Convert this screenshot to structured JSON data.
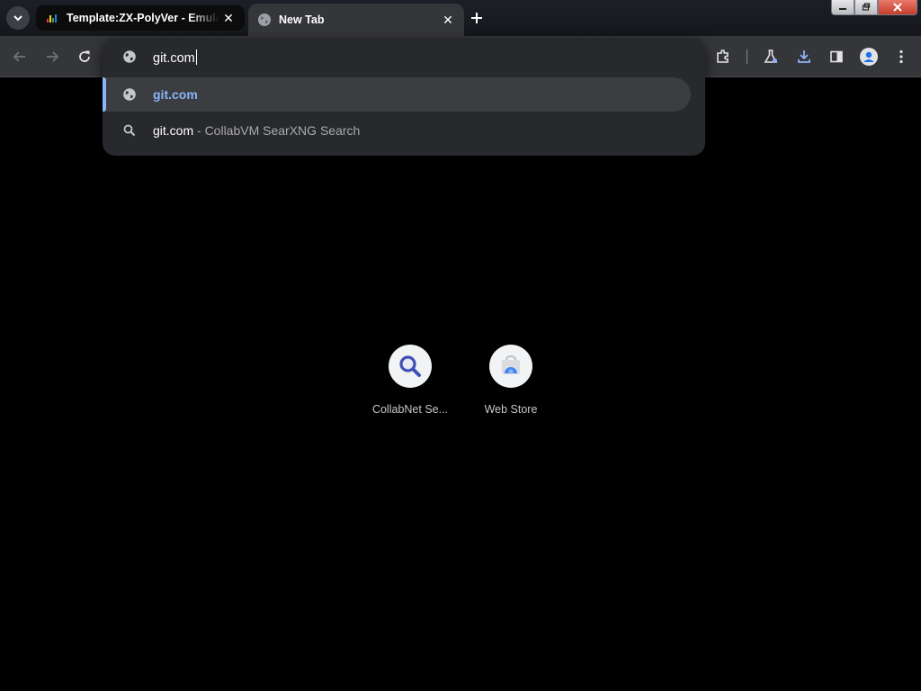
{
  "browser": {
    "tabs": [
      {
        "title": "Template:ZX-PolyVer - Emulati",
        "icon": "colorful-favicon-icon",
        "active": false
      },
      {
        "title": "New Tab",
        "icon": "globe-icon",
        "active": true
      }
    ],
    "new_tab_icon": "plus-icon",
    "tab_search_icon": "chevron-down-icon"
  },
  "toolbar": {
    "icons": [
      "back-icon",
      "forward-icon",
      "reload-icon",
      "extensions-icon",
      "labs-icon",
      "download-icon",
      "side-panel-icon",
      "profile-icon",
      "menu-icon"
    ]
  },
  "omnibox": {
    "value": "git.com",
    "suggestions": [
      {
        "text": "git.com",
        "icon": "globe-icon",
        "selected": true
      },
      {
        "text": "git.com",
        "suffix": "- CollabVM SearXNG Search",
        "icon": "search-icon",
        "selected": false
      }
    ]
  },
  "shortcuts": [
    {
      "label": "CollabNet Se...",
      "icon": "magnifier-icon"
    },
    {
      "label": "Web Store",
      "icon": "web-store-icon"
    }
  ],
  "colors": {
    "accent": "#8ab4f8",
    "toolbar": "#35363a",
    "omnibox": "#28292d",
    "page": "#000000"
  }
}
